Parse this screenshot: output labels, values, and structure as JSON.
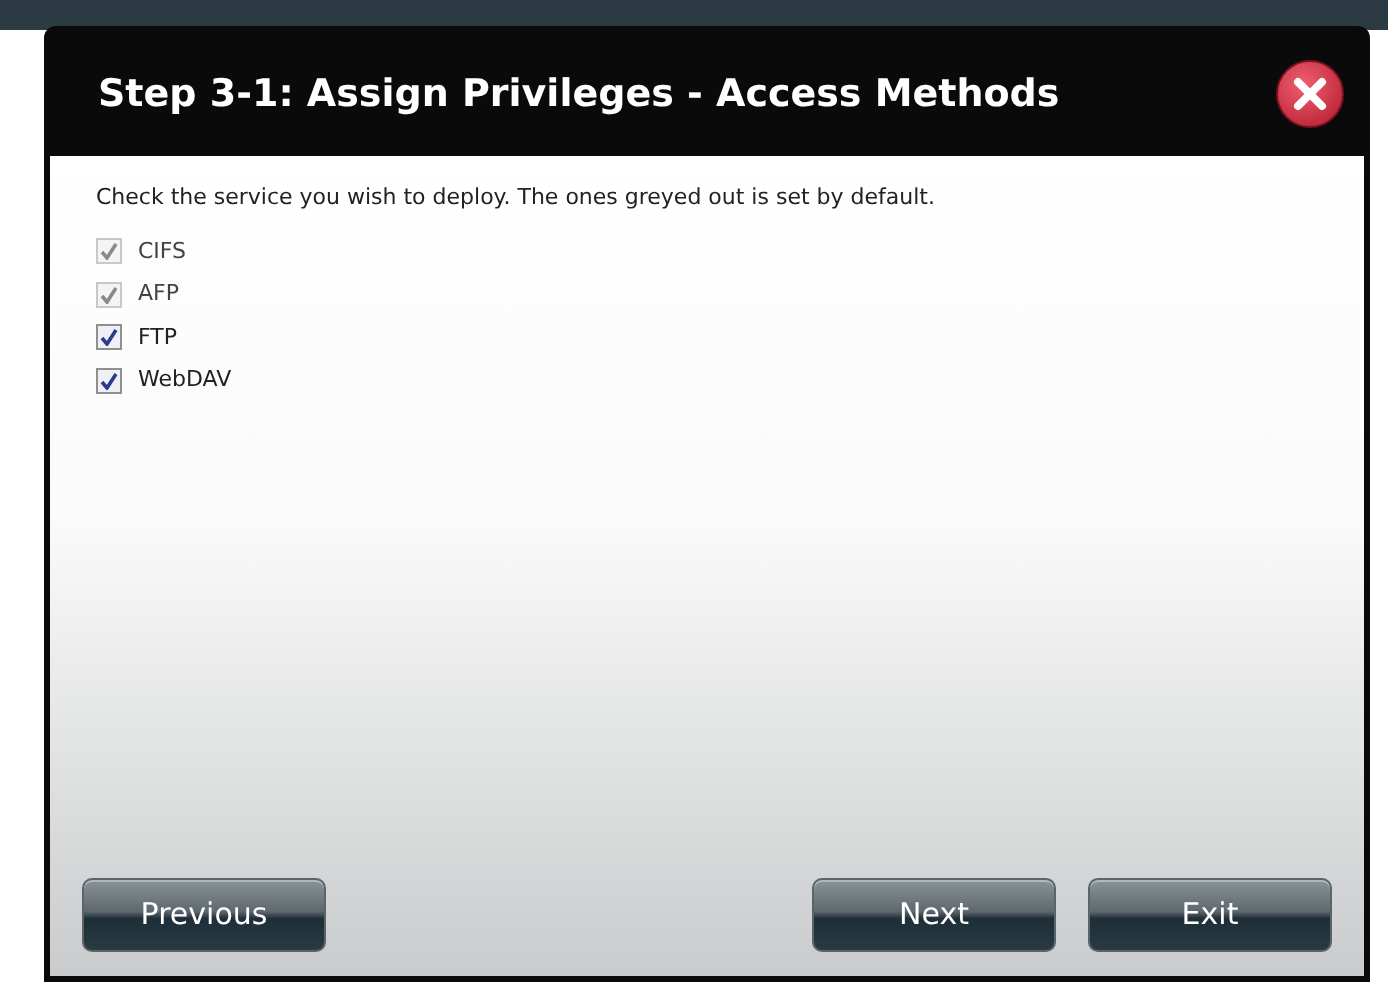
{
  "dialog": {
    "title": "Step 3-1: Assign Privileges - Access Methods",
    "instruction": "Check the service you wish to deploy. The ones greyed out is set by default.",
    "services": [
      {
        "label": "CIFS",
        "checked": true,
        "disabled": true
      },
      {
        "label": "AFP",
        "checked": true,
        "disabled": true
      },
      {
        "label": "FTP",
        "checked": true,
        "disabled": false
      },
      {
        "label": "WebDAV",
        "checked": true,
        "disabled": false
      }
    ],
    "buttons": {
      "left": [
        "Previous"
      ],
      "right": [
        "Next",
        "Exit"
      ]
    }
  }
}
